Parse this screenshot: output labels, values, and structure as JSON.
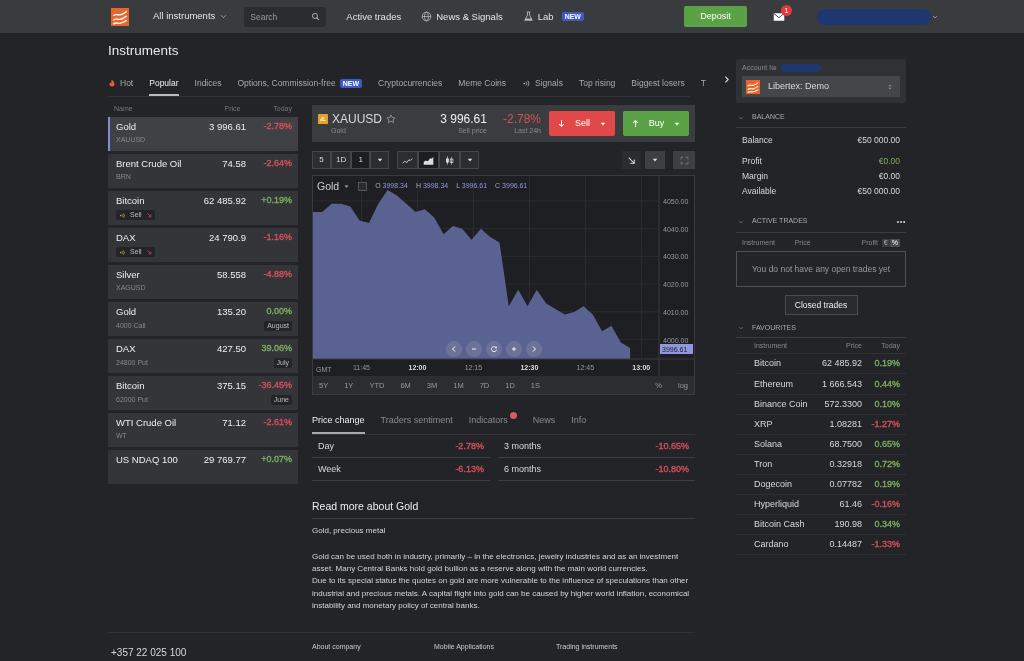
{
  "header": {
    "menu": "All instruments",
    "search": {
      "placeholder": "Search"
    },
    "links": [
      {
        "label": "Active trades",
        "kind": "plain"
      },
      {
        "label": "News & Signals",
        "kind": "globe"
      },
      {
        "label": "Lab",
        "kind": "flask",
        "badge": "NEW"
      }
    ],
    "deposit": "Deposit",
    "mail_badge": "1"
  },
  "page_title": "Instruments",
  "tabs": [
    {
      "label": "Hot",
      "kind": "fire",
      "selected": false
    },
    {
      "label": "Popular",
      "kind": "plain",
      "selected": true
    },
    {
      "label": "Indices",
      "kind": "plain",
      "selected": false
    },
    {
      "label": "Options, Commission-free",
      "kind": "plain",
      "badge": "NEW",
      "selected": false
    },
    {
      "label": "Cryptocurrencies",
      "kind": "plain",
      "selected": false
    },
    {
      "label": "Meme Coins",
      "kind": "plain",
      "selected": false
    },
    {
      "label": "Signals",
      "kind": "signal",
      "selected": false
    },
    {
      "label": "Top rising",
      "kind": "plain",
      "selected": false
    },
    {
      "label": "Biggest losers",
      "kind": "plain",
      "selected": false
    },
    {
      "label": "T",
      "kind": "plain",
      "selected": false
    }
  ],
  "instruments": {
    "columns": [
      "Name",
      "Price",
      "Today"
    ],
    "rows": [
      {
        "name": "Gold",
        "price": "3 996.61",
        "change": "-2.78%",
        "color": "#d5505c",
        "sub": "XAUUSD",
        "selected": true
      },
      {
        "name": "Brent Crude Oil",
        "price": "74.58",
        "change": "-2.64%",
        "color": "#d5505c",
        "sub": "BRN",
        "selected": false
      },
      {
        "name": "Bitcoin",
        "price": "62 485.92",
        "change": "+0.19%",
        "color": "#7fae5f",
        "signal": "Sell",
        "selected": false
      },
      {
        "name": "DAX",
        "price": "24 790.9",
        "change": "-1.16%",
        "color": "#d5505c",
        "signal": "Sell",
        "selected": false
      },
      {
        "name": "Silver",
        "price": "58.558",
        "change": "-4.88%",
        "color": "#d5505c",
        "sub": "XAGUSD",
        "selected": false
      },
      {
        "name": "Gold",
        "price": "135.20",
        "change": "0.00%",
        "color": "#7fae5f",
        "sub": "4000 Call",
        "expiry": "August",
        "selected": false
      },
      {
        "name": "DAX",
        "price": "427.50",
        "change": "39.06%",
        "color": "#7fae5f",
        "sub": "24800 Put",
        "expiry": "July",
        "selected": false
      },
      {
        "name": "Bitcoin",
        "price": "375.15",
        "change": "-36.45%",
        "color": "#d5505c",
        "sub": "62000 Put",
        "expiry": "June",
        "selected": false
      },
      {
        "name": "WTI Crude Oil",
        "price": "71.12",
        "change": "-2.61%",
        "color": "#d5505c",
        "sub": "WT",
        "selected": false
      },
      {
        "name": "US NDAQ 100",
        "price": "29 769.77",
        "change": "+0.07%",
        "color": "#7fae5f",
        "selected": false
      }
    ]
  },
  "quote": {
    "symbol": "XAUUSD",
    "name": "Gold",
    "price": "3 996.61",
    "price_label": "Sell price",
    "change": "-2.78%",
    "change_label": "Last 24h",
    "sell": "Sell",
    "buy": "Buy"
  },
  "toolbar": {
    "intervals": [
      {
        "label": "5",
        "selected": false
      },
      {
        "label": "1D",
        "selected": false
      },
      {
        "label": "1",
        "selected": true
      }
    ],
    "chart_types": [
      {
        "kind": "line",
        "selected": false
      },
      {
        "kind": "area",
        "selected": true
      },
      {
        "kind": "candles",
        "selected": false
      }
    ]
  },
  "chart": {
    "ohlc": [
      {
        "label": "O",
        "value": "3998.34"
      },
      {
        "label": "H",
        "value": "3998.34"
      },
      {
        "label": "L",
        "value": "3996.61"
      },
      {
        "label": "C",
        "value": "3996.61"
      }
    ],
    "timezone": "GMT",
    "price_tag": "3996.61",
    "chart_data": {
      "type": "area",
      "grid": true,
      "categories": [
        null,
        null,
        null,
        null,
        null,
        "11:45",
        null,
        null,
        null,
        null,
        null,
        "12:00",
        null,
        null,
        null,
        null,
        null,
        "12:15",
        null,
        null,
        null,
        null,
        null,
        "12:30",
        null,
        null,
        null,
        null,
        null,
        "12:45",
        null,
        null,
        null,
        null,
        null,
        "13:00"
      ],
      "series": [
        {
          "name": "Gold",
          "color": "#5a6291",
          "values": [
            4046,
            4046,
            4049,
            4049,
            4048,
            4043,
            4042,
            4049,
            4054,
            4052,
            4049,
            4046,
            4047,
            4044,
            4038,
            4041,
            4040,
            4036,
            4040,
            4037,
            4035,
            4012,
            4018,
            4012,
            4018,
            4013,
            4011,
            4009,
            4010,
            4012,
            4009,
            4003,
            4005,
            3999,
            3997,
            null
          ]
        }
      ],
      "ylim": [
        3993,
        4059
      ],
      "yticks": [
        {
          "value": 4000,
          "label": "4000.00"
        },
        {
          "value": 4010,
          "label": "4010.00"
        },
        {
          "value": 4020,
          "label": "4020.00"
        },
        {
          "value": 4030,
          "label": "4030.00"
        },
        {
          "value": 4040,
          "label": "4040.00"
        },
        {
          "value": 4050,
          "label": "4050.00"
        }
      ]
    },
    "ranges": [
      "5Y",
      "1Y",
      "YTD",
      "6M",
      "3M",
      "1M",
      "7D",
      "1D",
      "1S"
    ],
    "scale_options": [
      "%",
      "log"
    ]
  },
  "detail_tabs": [
    {
      "label": "Price change",
      "selected": true
    },
    {
      "label": "Traders sentiment",
      "selected": false
    },
    {
      "label": "Indicators",
      "selected": false,
      "alert": true
    },
    {
      "label": "News",
      "selected": false
    },
    {
      "label": "Info",
      "selected": false
    }
  ],
  "price_change": [
    [
      {
        "label": "Day",
        "value": "-2.78%",
        "color": "#d5505c"
      },
      {
        "label": "Week",
        "value": "-6.13%",
        "color": "#d5505c"
      }
    ],
    [
      {
        "label": "3 months",
        "value": "-10.65%",
        "color": "#d5505c"
      },
      {
        "label": "6 months",
        "value": "-10.80%",
        "color": "#d5505c"
      }
    ]
  ],
  "about": {
    "title": "Read more about Gold",
    "subtitle": "Gold, precious metal",
    "paragraphs": [
      "Gold can be used both in industry, primarily – in the electronics, jewelry industries and as an investment asset. Many Central Banks hold gold bullion as a reserve along with the main world currencies.",
      "Due to its special status the quotes on gold are more vulnerable to the influence of speculations than other industrial and precious metals. A capital flight into gold can be caused by higher world inflation, economical instability and monetary policy of central banks."
    ]
  },
  "footer": {
    "phone": "+357 22 025 100",
    "links": [
      "About company",
      "Mobile Applications",
      "Trading instruments"
    ]
  },
  "account": {
    "label": "Account №",
    "selected_account": "Libertex: Demo"
  },
  "balance": {
    "title": "BALANCE",
    "rows": [
      {
        "label": "Balance",
        "value": "€50 000.00",
        "kind": "plain"
      },
      {
        "label": "Profit",
        "value": "€0.00",
        "kind": "profit"
      },
      {
        "label": "Margin",
        "value": "€0.00",
        "kind": "plain"
      },
      {
        "label": "Available",
        "value": "€50 000.00",
        "kind": "plain"
      }
    ]
  },
  "active_trades": {
    "title": "ACTIVE TRADES",
    "columns": [
      "Instrument",
      "Price",
      "Profit"
    ],
    "units": [
      {
        "label": "€",
        "selected": false
      },
      {
        "label": "%",
        "selected": true
      }
    ],
    "empty": "You do not have any open trades yet",
    "button": "Closed trades"
  },
  "favourites": {
    "title": "FAVOURITES",
    "columns": [
      "Instrument",
      "Price",
      "Today"
    ],
    "rows": [
      {
        "name": "Bitcoin",
        "price": "62 485.92",
        "change": "0.19%",
        "color": "#7fae5f"
      },
      {
        "name": "Ethereum",
        "price": "1 666.543",
        "change": "0.44%",
        "color": "#7fae5f"
      },
      {
        "name": "Binance Coin",
        "price": "572.3300",
        "change": "0.10%",
        "color": "#7fae5f"
      },
      {
        "name": "XRP",
        "price": "1.08281",
        "change": "-1.27%",
        "color": "#d5505c"
      },
      {
        "name": "Solana",
        "price": "68.7500",
        "change": "0.65%",
        "color": "#7fae5f"
      },
      {
        "name": "Tron",
        "price": "0.32918",
        "change": "0.72%",
        "color": "#7fae5f"
      },
      {
        "name": "Dogecoin",
        "price": "0.07782",
        "change": "0.19%",
        "color": "#7fae5f"
      },
      {
        "name": "Hyperliquid",
        "price": "61.46",
        "change": "-0.16%",
        "color": "#d5505c"
      },
      {
        "name": "Bitcoin Cash",
        "price": "190.98",
        "change": "0.34%",
        "color": "#7fae5f"
      },
      {
        "name": "Cardano",
        "price": "0.14487",
        "change": "-1.33%",
        "color": "#d5505c"
      }
    ]
  }
}
